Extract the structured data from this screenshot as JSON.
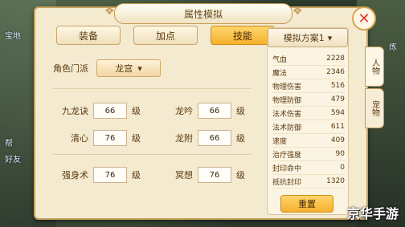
{
  "game_bg": {
    "left_labels": [
      "宝地",
      "帮",
      "好友"
    ],
    "right_labels": [
      "炼"
    ]
  },
  "dialog": {
    "title": "属性模拟",
    "tabs": [
      {
        "label": "装备",
        "active": false
      },
      {
        "label": "加点",
        "active": false
      },
      {
        "label": "技能",
        "active": true
      }
    ],
    "school": {
      "label": "角色门派",
      "value": "龙宫"
    },
    "skills": [
      {
        "name": "九龙诀",
        "value": "66",
        "unit": "级"
      },
      {
        "name": "龙吟",
        "value": "66",
        "unit": "级"
      },
      {
        "name": "清心",
        "value": "76",
        "unit": "级"
      },
      {
        "name": "龙附",
        "value": "66",
        "unit": "级"
      },
      {
        "name": "强身术",
        "value": "76",
        "unit": "级"
      },
      {
        "name": "冥想",
        "value": "76",
        "unit": "级"
      }
    ],
    "plan": {
      "label": "模拟方案1"
    },
    "stats": [
      {
        "name": "气血",
        "value": "2228"
      },
      {
        "name": "魔法",
        "value": "2346"
      },
      {
        "name": "物理伤害",
        "value": "516"
      },
      {
        "name": "物理防御",
        "value": "479"
      },
      {
        "name": "法术伤害",
        "value": "594"
      },
      {
        "name": "法术防御",
        "value": "611"
      },
      {
        "name": "速度",
        "value": "409"
      },
      {
        "name": "治疗强度",
        "value": "90"
      },
      {
        "name": "封印命中",
        "value": "0"
      },
      {
        "name": "抵抗封印",
        "value": "1320"
      }
    ],
    "reset_label": "重置",
    "side_tabs": [
      {
        "label": "人物",
        "active": true
      },
      {
        "label": "宠物",
        "active": false
      }
    ]
  },
  "watermark": "京华手游",
  "colors": {
    "accent": "#f4b12e",
    "panel_bg": "#f4ead0",
    "close_red": "#e23b2a"
  }
}
